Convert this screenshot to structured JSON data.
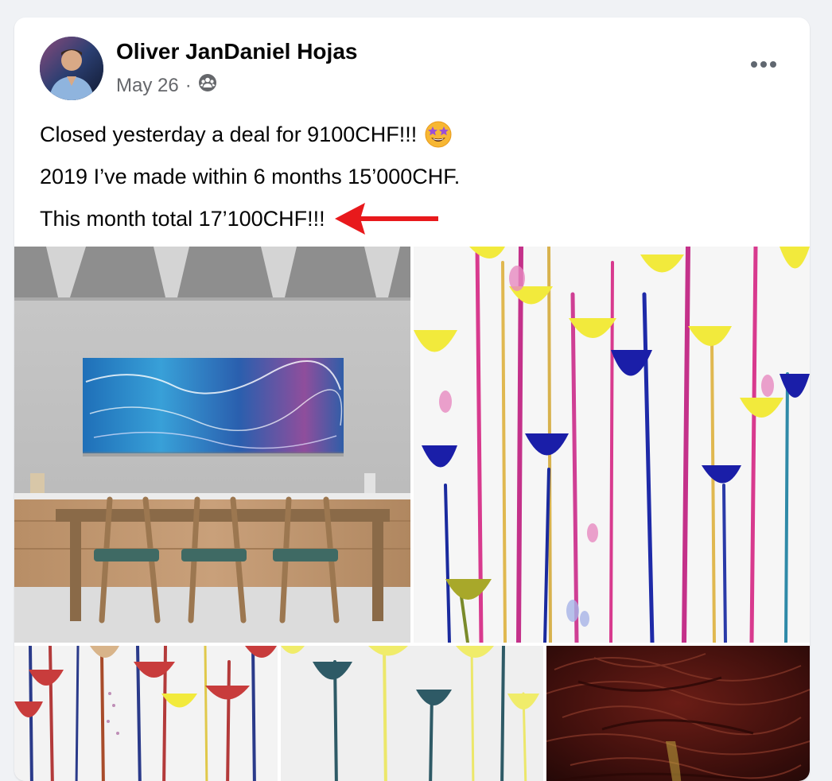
{
  "post": {
    "author": "Oliver JanDaniel Hojas",
    "date": "May 26",
    "separator": "·",
    "audience_icon": "group-audience-icon",
    "more_icon": "more-options-icon",
    "lines": [
      "Closed yesterday a deal for 9100CHF!!!",
      "2019 I’ve made within 6 months 15’000CHF.",
      "This month total 17’100CHF!!!"
    ],
    "emoji_icon": "star-struck-emoji-icon",
    "annotation": "red-arrow-annotation",
    "annotation_color": "#e8191c"
  },
  "photos": [
    {
      "icon": "dining-room-painting-photo"
    },
    {
      "icon": "drip-flowers-painting-photo"
    },
    {
      "icon": "red-drip-flowers-painting-photo"
    },
    {
      "icon": "teal-drip-flowers-painting-photo"
    },
    {
      "icon": "dark-red-texture-painting-photo"
    }
  ],
  "colors": {
    "background": "#f0f2f5",
    "card": "#ffffff",
    "text": "#050505",
    "secondary_text": "#65676b"
  }
}
